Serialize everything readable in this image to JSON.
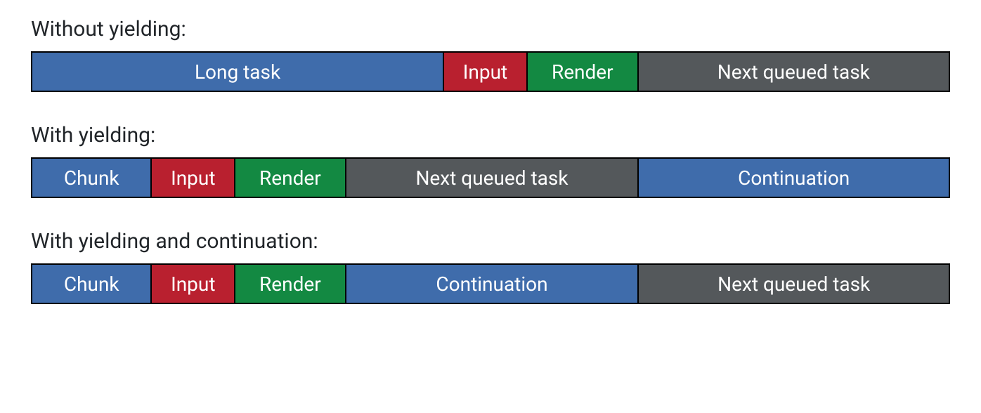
{
  "sections": [
    {
      "title": "Without yielding:",
      "segments": [
        {
          "label": "Long task",
          "color": "blue",
          "flex": 45
        },
        {
          "label": "Input",
          "color": "red",
          "flex": 9
        },
        {
          "label": "Render",
          "color": "green",
          "flex": 12
        },
        {
          "label": "Next queued task",
          "color": "gray",
          "flex": 34
        }
      ]
    },
    {
      "title": "With yielding:",
      "segments": [
        {
          "label": "Chunk",
          "color": "blue",
          "flex": 13
        },
        {
          "label": "Input",
          "color": "red",
          "flex": 9
        },
        {
          "label": "Render",
          "color": "green",
          "flex": 12
        },
        {
          "label": "Next queued task",
          "color": "gray",
          "flex": 32
        },
        {
          "label": "Continuation",
          "color": "blue",
          "flex": 34
        }
      ]
    },
    {
      "title": "With yielding and continuation:",
      "segments": [
        {
          "label": "Chunk",
          "color": "blue",
          "flex": 13
        },
        {
          "label": "Input",
          "color": "red",
          "flex": 9
        },
        {
          "label": "Render",
          "color": "green",
          "flex": 12
        },
        {
          "label": "Continuation",
          "color": "blue",
          "flex": 32
        },
        {
          "label": "Next queued task",
          "color": "gray",
          "flex": 34
        }
      ]
    }
  ],
  "colors": {
    "blue": "#3f6cab",
    "red": "#b9202f",
    "green": "#138942",
    "gray": "#54585b"
  }
}
